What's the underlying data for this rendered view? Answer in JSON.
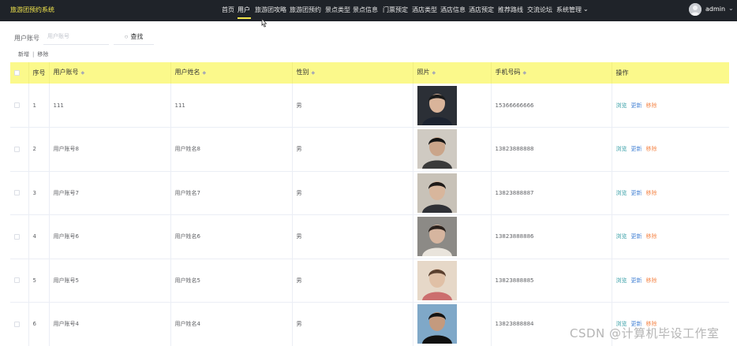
{
  "header": {
    "brand": "旅游团预约系统",
    "nav": [
      {
        "label": "首页",
        "active": false
      },
      {
        "label": "用户",
        "active": true
      },
      {
        "label": "旅游团攻略",
        "active": false
      },
      {
        "label": "旅游团预约",
        "active": false
      },
      {
        "label": "景点类型",
        "active": false
      },
      {
        "label": "景点信息",
        "active": false
      },
      {
        "label": "门票预定",
        "active": false
      },
      {
        "label": "酒店类型",
        "active": false
      },
      {
        "label": "酒店信息",
        "active": false
      },
      {
        "label": "酒店预定",
        "active": false
      },
      {
        "label": "推荐路线",
        "active": false
      },
      {
        "label": "交流论坛",
        "active": false
      },
      {
        "label": "系统管理",
        "active": false
      }
    ],
    "user": "admin",
    "caret": "⌄",
    "accent": "#f6e94d"
  },
  "search": {
    "label": "用户账号",
    "placeholder": "用户账号",
    "button_icon": "search-icon",
    "button_label": "查找"
  },
  "ops": {
    "add": "新增",
    "separator": "|",
    "remove": "移除"
  },
  "table": {
    "columns": [
      "序号",
      "用户账号",
      "用户姓名",
      "性别",
      "照片",
      "手机号码",
      "操作"
    ],
    "rows": [
      {
        "index": "1",
        "account": "111",
        "name": "111",
        "gender": "男",
        "phone": "15366666666"
      },
      {
        "index": "2",
        "account": "用户账号8",
        "name": "用户姓名8",
        "gender": "男",
        "phone": "13823888888"
      },
      {
        "index": "3",
        "account": "用户账号7",
        "name": "用户姓名7",
        "gender": "男",
        "phone": "13823888887"
      },
      {
        "index": "4",
        "account": "用户账号6",
        "name": "用户姓名6",
        "gender": "男",
        "phone": "13823888886"
      },
      {
        "index": "5",
        "account": "用户账号5",
        "name": "用户姓名5",
        "gender": "男",
        "phone": "13823888885"
      },
      {
        "index": "6",
        "account": "用户账号4",
        "name": "用户姓名4",
        "gender": "男",
        "phone": "13823888884"
      }
    ],
    "actions": {
      "view": "浏览",
      "edit": "更新",
      "delete": "移除"
    },
    "header_color": "#fbf98b"
  },
  "watermark": "CSDN @计算机毕设工作室"
}
